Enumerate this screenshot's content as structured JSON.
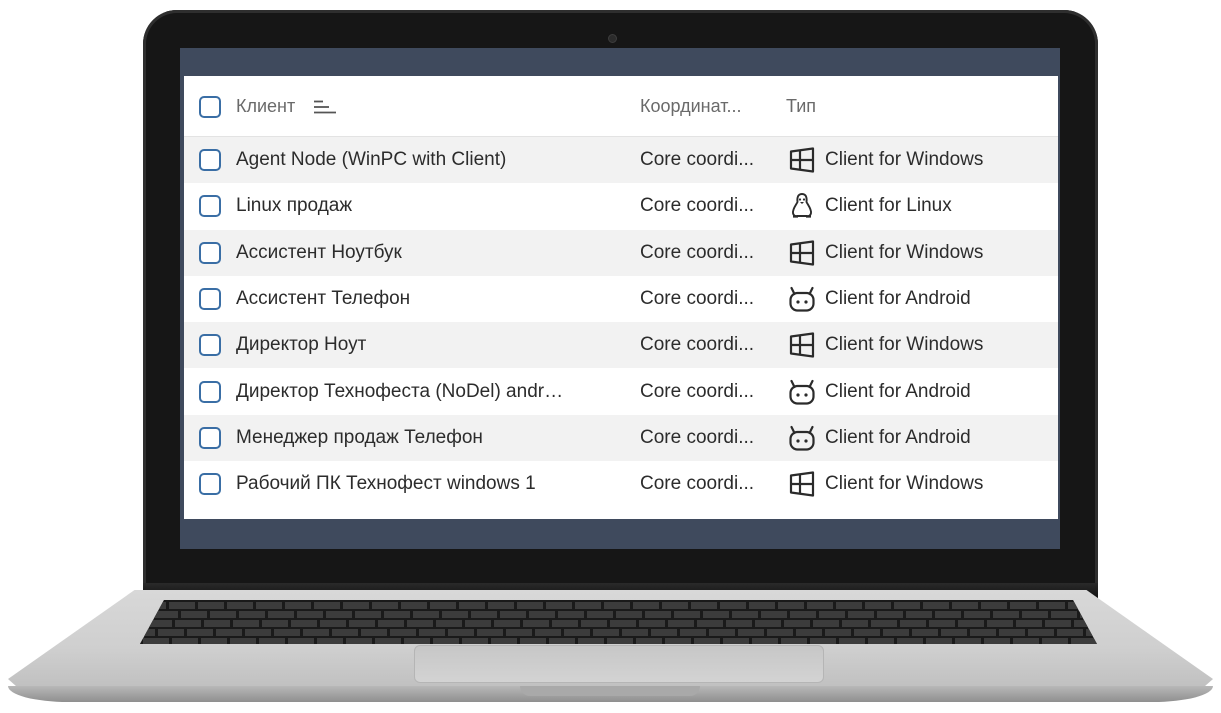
{
  "table": {
    "header": {
      "client": "Клиент",
      "coordinator": "Координат...",
      "type": "Тип"
    },
    "rows": [
      {
        "client": "Agent Node (WinPC with Client)",
        "coordinator": "Core coordi...",
        "type_icon": "windows-icon",
        "type": "Client for Windows"
      },
      {
        "client": "Linux продаж",
        "coordinator": "Core coordi...",
        "type_icon": "linux-icon",
        "type": "Client for Linux"
      },
      {
        "client": "Ассистент Ноутбук",
        "coordinator": "Core coordi...",
        "type_icon": "windows-icon",
        "type": "Client for Windows"
      },
      {
        "client": "Ассистент Телефон",
        "coordinator": "Core coordi...",
        "type_icon": "android-icon",
        "type": "Client for Android"
      },
      {
        "client": "Директор Ноут",
        "coordinator": "Core coordi...",
        "type_icon": "windows-icon",
        "type": "Client for Windows"
      },
      {
        "client": "Директор Технофеста (NoDel) androi...",
        "coordinator": "Core coordi...",
        "type_icon": "android-icon",
        "type": "Client for Android"
      },
      {
        "client": "Менеджер продаж Телефон",
        "coordinator": "Core coordi...",
        "type_icon": "android-icon",
        "type": "Client for Android"
      },
      {
        "client": "Рабочий ПК Технофест windows 1",
        "coordinator": "Core coordi...",
        "type_icon": "windows-icon",
        "type": "Client for Windows"
      }
    ]
  },
  "colors": {
    "checkbox_border": "#3a6ea5",
    "bar": "#3f4a5d",
    "row_alt": "#f2f2f2"
  }
}
